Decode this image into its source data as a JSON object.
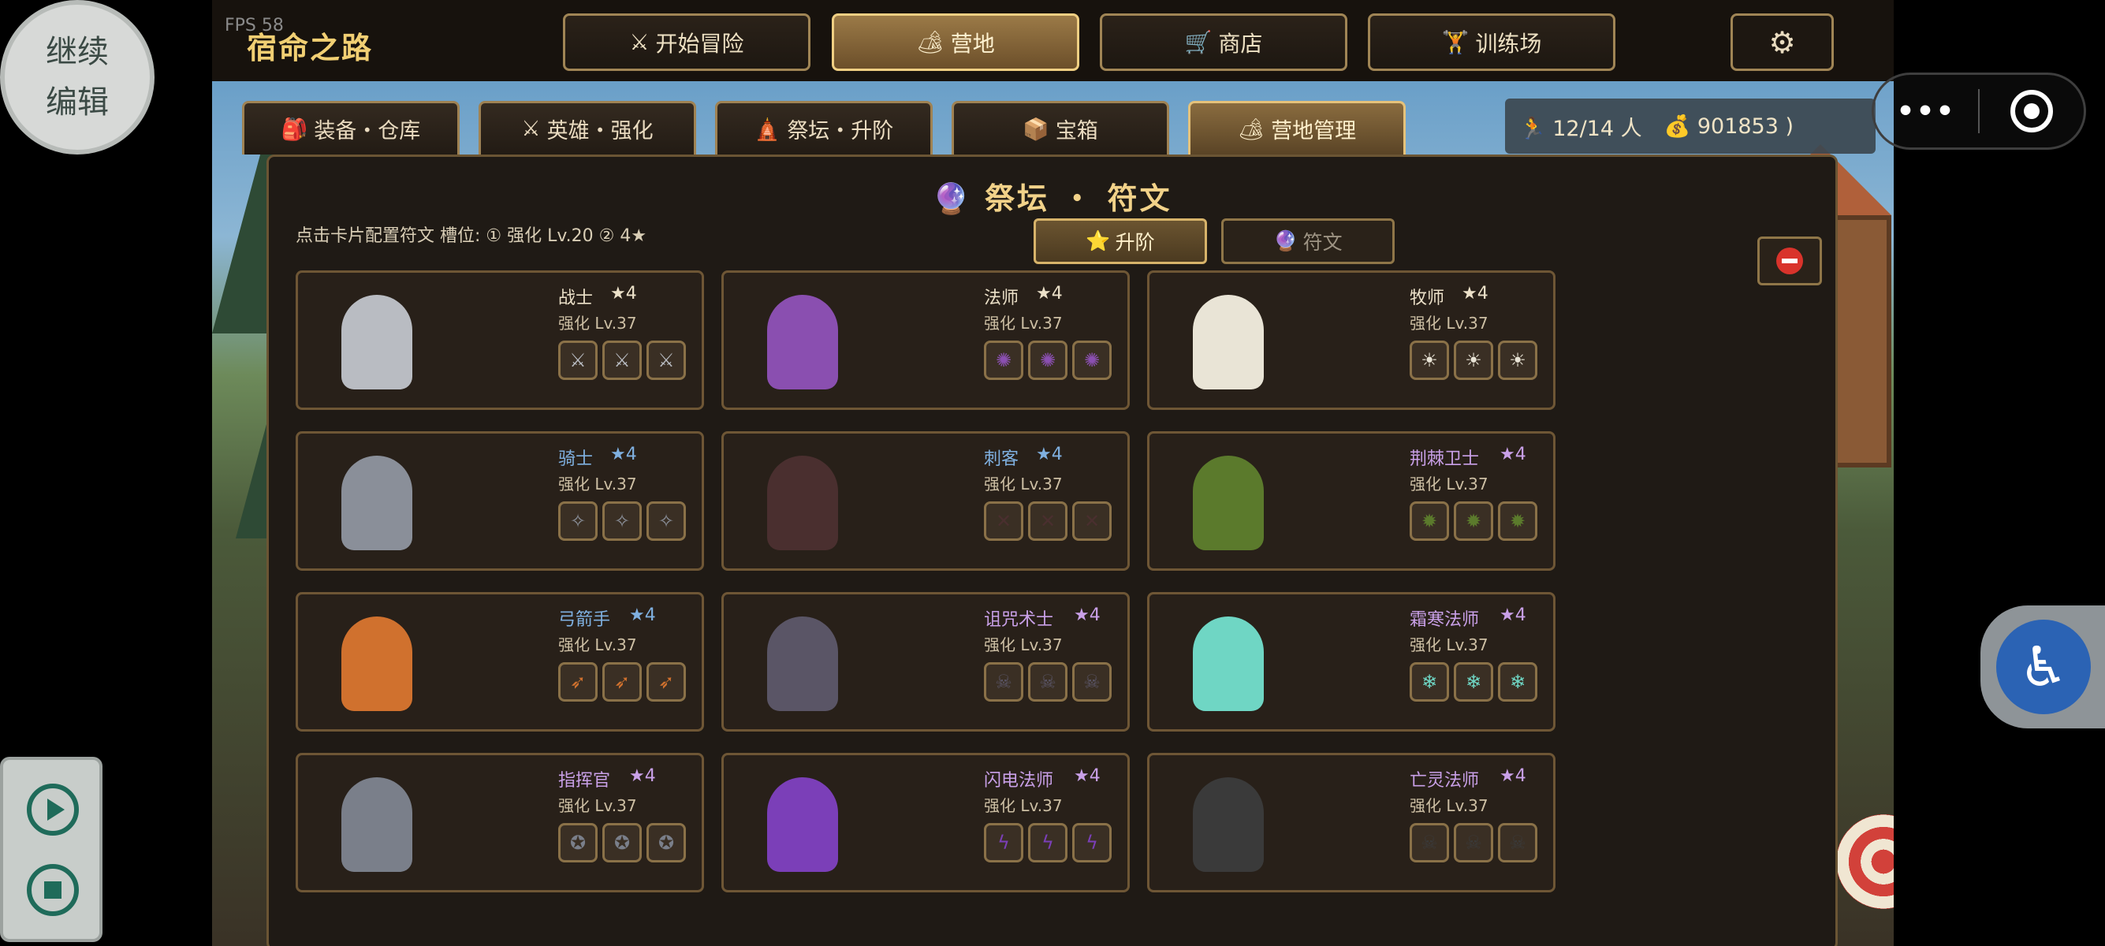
{
  "fps": "FPS 58",
  "game_title": "宿命之路",
  "nav": [
    {
      "icon": "⚔",
      "label": "开始冒险",
      "active": false
    },
    {
      "icon": "🏕",
      "label": "营地",
      "active": true
    },
    {
      "icon": "🛒",
      "label": "商店",
      "active": false
    },
    {
      "icon": "🏋",
      "label": "训练场",
      "active": false
    }
  ],
  "settings_icon": "⚙",
  "tabs": [
    {
      "icon": "🎒",
      "label": "装备・仓库"
    },
    {
      "icon": "⚔",
      "label": "英雄・强化"
    },
    {
      "icon": "🛕",
      "label": "祭坛・升阶"
    },
    {
      "icon": "📦",
      "label": "宝箱"
    },
    {
      "icon": "🏕",
      "label": "营地管理"
    }
  ],
  "resources": {
    "people_icon": "🏃",
    "people": "12/14 人",
    "coin_icon": "💰",
    "coins": "901853 )"
  },
  "panel": {
    "title_icon": "🔮",
    "title": "祭坛 ・ 符文",
    "hint": "点击卡片配置符文    槽位: ① 强化 Lv.20    ② 4★",
    "subtabs": [
      {
        "icon": "⭐",
        "label": "升阶",
        "active": true
      },
      {
        "icon": "🔮",
        "label": "符文",
        "active": false
      }
    ]
  },
  "heroes": [
    {
      "name": "战士",
      "star": "★4",
      "lv": "强化 Lv.37",
      "rune": "⚔",
      "name_color": "#ece1c9",
      "color": "#b9bcc2"
    },
    {
      "name": "法师",
      "star": "★4",
      "lv": "强化 Lv.37",
      "rune": "✺",
      "name_color": "#ece1c9",
      "color": "#8a4fb0"
    },
    {
      "name": "牧师",
      "star": "★4",
      "lv": "强化 Lv.37",
      "rune": "☀",
      "name_color": "#ece1c9",
      "color": "#e9e4d6"
    },
    {
      "name": "骑士",
      "star": "★4",
      "lv": "强化 Lv.37",
      "rune": "✧",
      "name_color": "#7fb0e0",
      "color": "#8a8f99"
    },
    {
      "name": "刺客",
      "star": "★4",
      "lv": "强化 Lv.37",
      "rune": "✕",
      "name_color": "#7fb0e0",
      "color": "#4a2f2f"
    },
    {
      "name": "荆棘卫士",
      "star": "★4",
      "lv": "强化 Lv.37",
      "rune": "✹",
      "name_color": "#c9a0e8",
      "color": "#5b7a2c"
    },
    {
      "name": "弓箭手",
      "star": "★4",
      "lv": "强化 Lv.37",
      "rune": "➶",
      "name_color": "#7fb0e0",
      "color": "#d0712e"
    },
    {
      "name": "诅咒术士",
      "star": "★4",
      "lv": "强化 Lv.37",
      "rune": "☠",
      "name_color": "#c9a0e8",
      "color": "#5a5566"
    },
    {
      "name": "霜寒法师",
      "star": "★4",
      "lv": "强化 Lv.37",
      "rune": "❄",
      "name_color": "#c9a0e8",
      "color": "#6fd6c4"
    },
    {
      "name": "指挥官",
      "star": "★4",
      "lv": "强化 Lv.37",
      "rune": "✪",
      "name_color": "#c9a0e8",
      "color": "#7a7f8a"
    },
    {
      "name": "闪电法师",
      "star": "★4",
      "lv": "强化 Lv.37",
      "rune": "ϟ",
      "name_color": "#c9a0e8",
      "color": "#7b3fb8"
    },
    {
      "name": "亡灵法师",
      "star": "★4",
      "lv": "强化 Lv.37",
      "rune": "☠",
      "name_color": "#c9a0e8",
      "color": "#3a3a3a"
    }
  ],
  "overlays": {
    "continue_line1": "继续",
    "continue_line2": "编辑",
    "more_icon": "•••",
    "accessibility_icon": "♿"
  }
}
